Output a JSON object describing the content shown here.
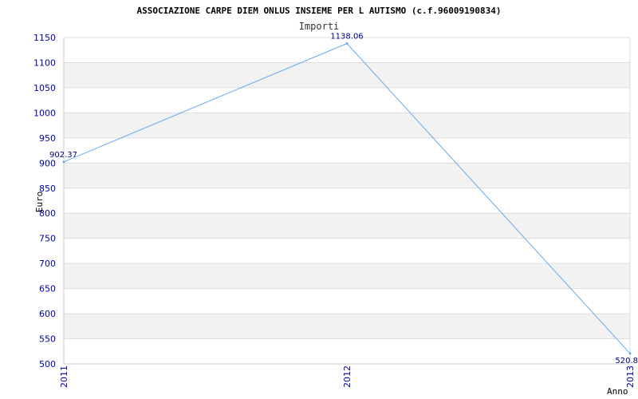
{
  "chart_data": {
    "type": "line",
    "title": "ASSOCIAZIONE CARPE DIEM ONLUS INSIEME PER L AUTISMO (c.f.96009190834)",
    "subtitle": "Importi",
    "xlabel": "Anno",
    "ylabel": "Euro",
    "categories": [
      "2011",
      "2012",
      "2013"
    ],
    "values": [
      902.37,
      1138.06,
      520.8
    ],
    "data_labels": [
      "902.37",
      "1138.06",
      "520.8"
    ],
    "ylim": [
      500,
      1150
    ],
    "yticks": [
      500,
      550,
      600,
      650,
      700,
      750,
      800,
      850,
      900,
      950,
      1000,
      1050,
      1100,
      1150
    ],
    "grid": true,
    "colors": {
      "line": "#66aaee",
      "band": "#f2f2f2",
      "grid": "#dddddd",
      "tick_text": "#0000aa",
      "label_text": "#000080"
    }
  }
}
